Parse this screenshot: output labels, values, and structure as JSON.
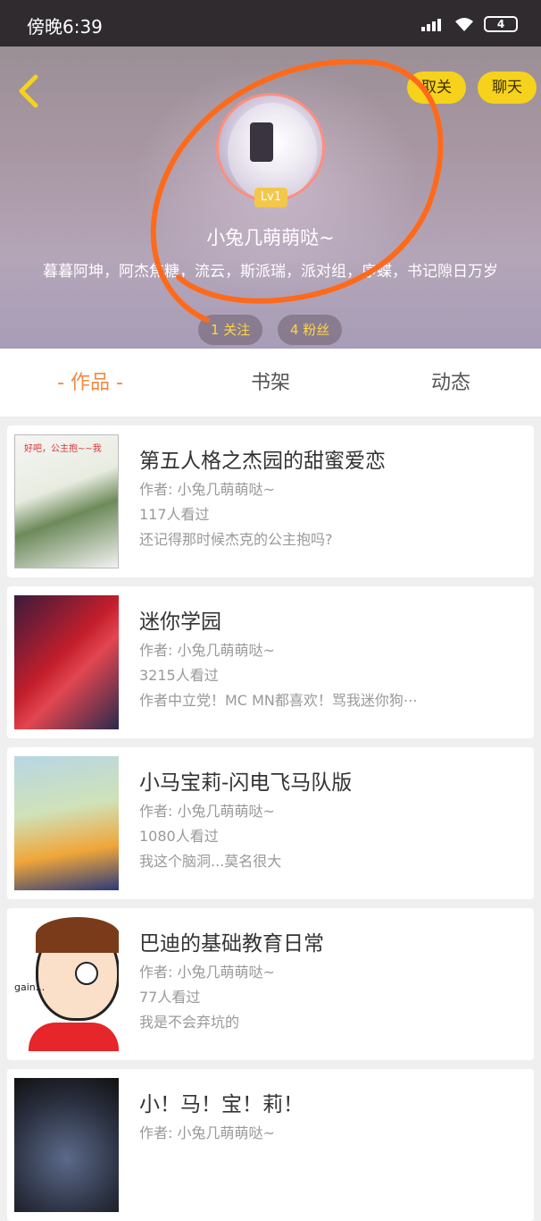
{
  "status_bar": {
    "time": "傍晚6:39",
    "battery": "4",
    "icons": [
      "signal-icon",
      "wifi-icon",
      "battery-icon"
    ]
  },
  "header": {
    "back_icon": "chevron-left-icon",
    "unfollow_label": "取关",
    "chat_label": "聊天",
    "level": "Lv1",
    "username": "小兔几萌萌哒~",
    "tags": "暮暮阿坤，阿杰焦糖，流云，斯派瑞，派对组，序蝶，书记隙日万岁",
    "following": "1 关注",
    "fans": "4 粉丝",
    "accent_color": "#f6d21c",
    "annotation_color": "#ff6a1a"
  },
  "tabs": [
    {
      "label": "- 作品 -",
      "active": true
    },
    {
      "label": "书架",
      "active": false
    },
    {
      "label": "动态",
      "active": false
    }
  ],
  "works": [
    {
      "title": "第五人格之杰园的甜蜜爱恋",
      "author": "作者: 小兔几萌萌哒~",
      "views": "117人看过",
      "desc": "还记得那时候杰克的公主抱吗?",
      "cover_text": "好吧，公主抱~~我"
    },
    {
      "title": "迷你学园",
      "author": "作者: 小兔几萌萌哒~",
      "views": "3215人看过",
      "desc": "作者中立党！MC MN都喜欢！骂我迷你狗⋯"
    },
    {
      "title": "小马宝莉-闪电飞马队版",
      "author": "作者: 小兔几萌萌哒~",
      "views": "1080人看过",
      "desc": "我这个脑洞...莫名很大"
    },
    {
      "title": "巴迪的基础教育日常",
      "author": "作者: 小兔几萌萌哒~",
      "views": "77人看过",
      "desc": "我是不会弃坑的",
      "cover_text": "gain..."
    },
    {
      "title": "小！马！宝！莉！",
      "author": "作者: 小兔几萌萌哒~"
    }
  ]
}
